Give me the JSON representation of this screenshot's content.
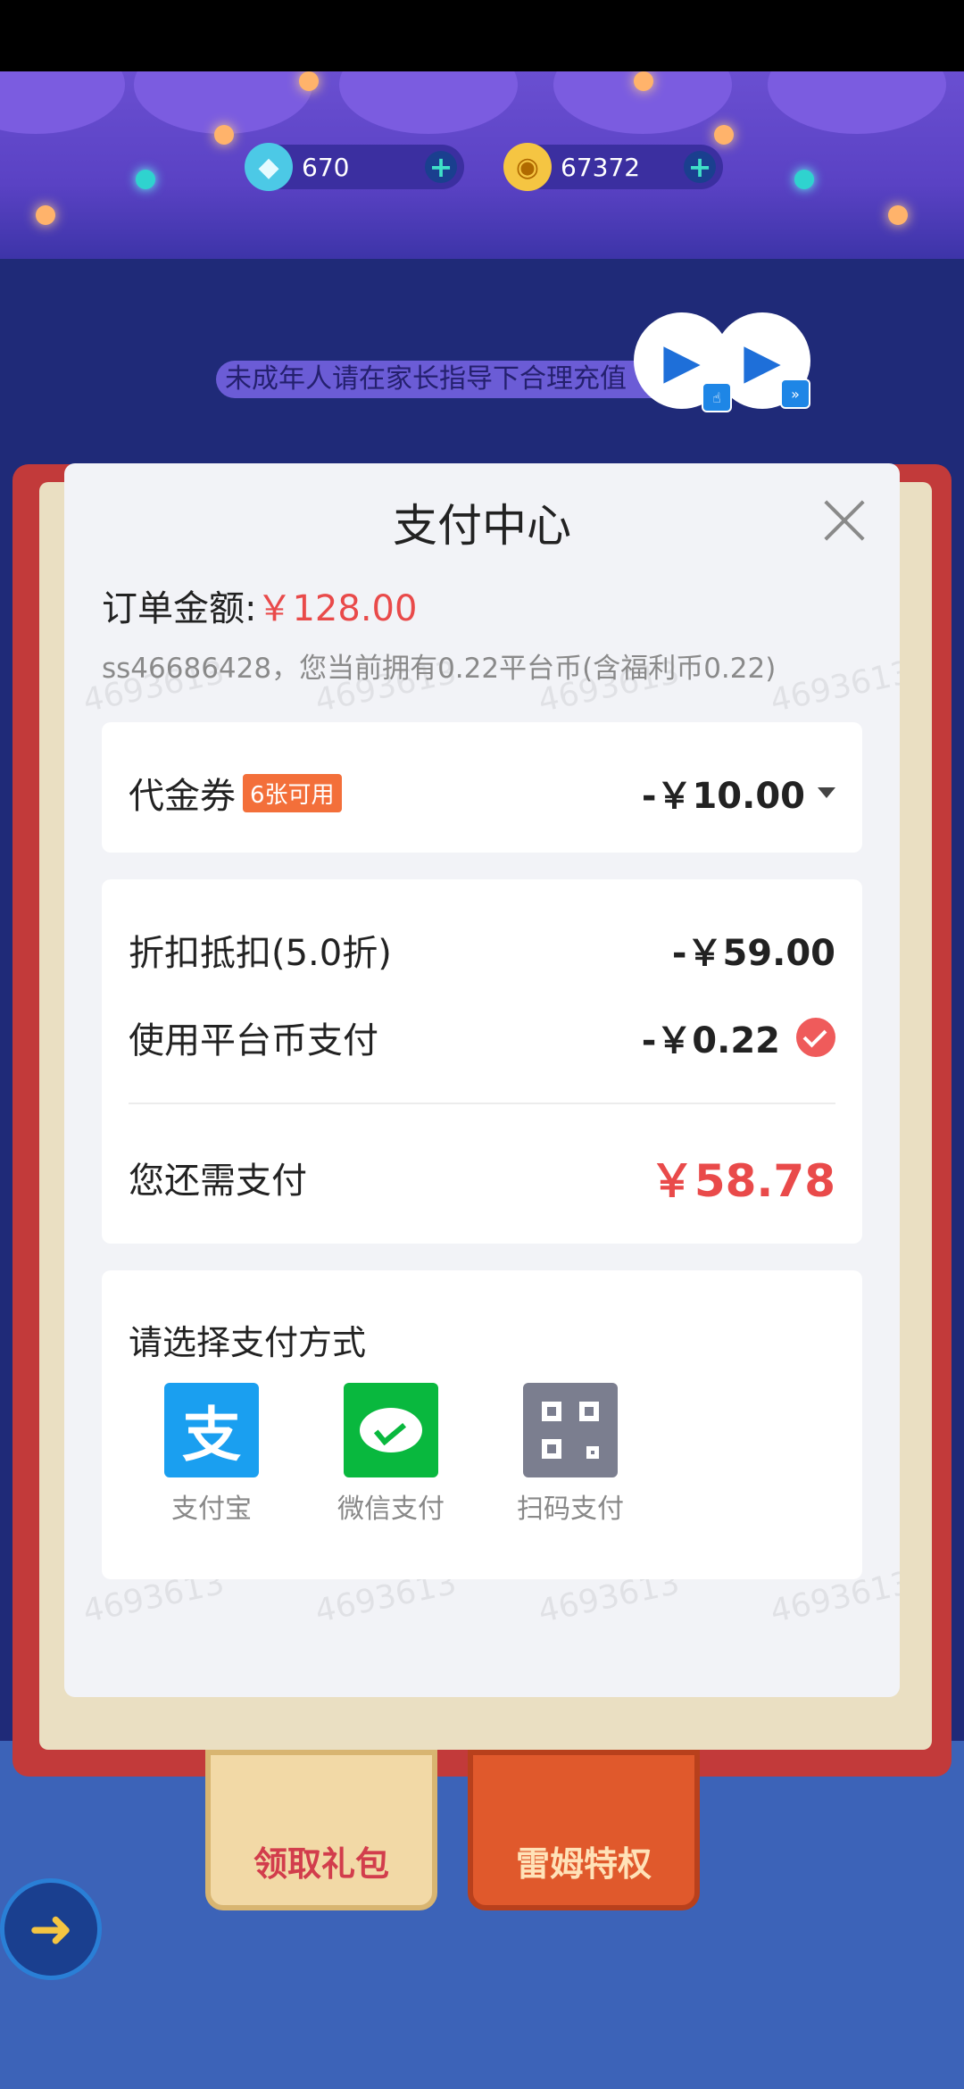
{
  "game": {
    "gems": "670",
    "coins": "67372",
    "plus_symbol": "+",
    "notice": "未成年人请在家长指导下合理充值",
    "tags": [
      "领取礼包",
      "雷姆特权"
    ]
  },
  "modal": {
    "title": "支付中心",
    "order_label": "订单金额:",
    "order_amount": "￥128.00",
    "account_info": "ss46686428，您当前拥有0.22平台币(含福利币0.22)",
    "watermark": "4693613",
    "voucher": {
      "label": "代金券",
      "badge": "6张可用",
      "value": "-￥10.00"
    },
    "discount": {
      "label": "折扣抵扣(5.0折)",
      "value": "-￥59.00"
    },
    "platform_coin": {
      "label": "使用平台币支付",
      "value": "-￥0.22",
      "checked": true
    },
    "remaining": {
      "label": "您还需支付",
      "value": "￥58.78"
    },
    "methods_title": "请选择支付方式",
    "methods": [
      {
        "label": "支付宝",
        "icon": "alipay-icon",
        "glyph": "支"
      },
      {
        "label": "微信支付",
        "icon": "wechat-pay-icon"
      },
      {
        "label": "扫码支付",
        "icon": "qr-scan-icon"
      }
    ]
  },
  "colors": {
    "accent_red": "#e94a4a",
    "alipay_blue": "#1a9ff0",
    "wechat_green": "#09b83e"
  }
}
